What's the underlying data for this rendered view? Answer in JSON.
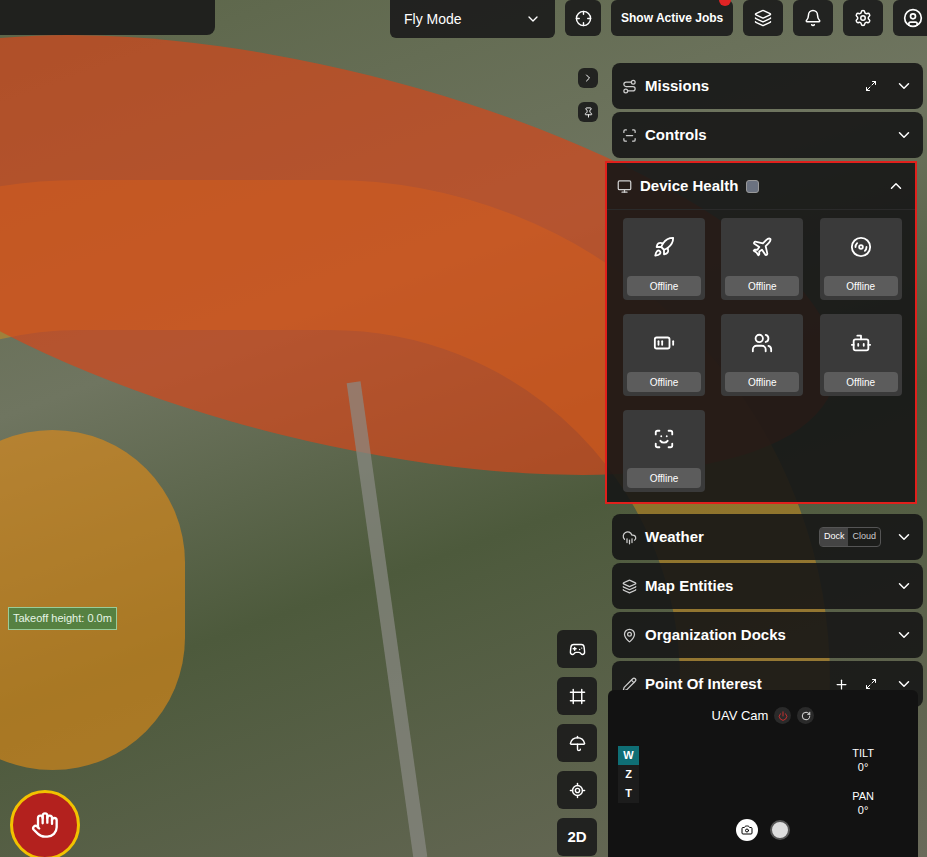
{
  "top_bar": {
    "mode_select": {
      "value": "Fly Mode"
    },
    "active_jobs_button": {
      "label": "Show Active Jobs",
      "has_badge": true
    }
  },
  "panel": {
    "sections": [
      {
        "title": "Missions",
        "expanded": false
      },
      {
        "title": "Controls",
        "expanded": false
      },
      {
        "title": "Device Health",
        "expanded": true,
        "highlighted": true,
        "checked": false,
        "tiles": [
          {
            "status": "Offline"
          },
          {
            "status": "Offline"
          },
          {
            "status": "Offline"
          },
          {
            "status": "Offline"
          },
          {
            "status": "Offline"
          },
          {
            "status": "Offline"
          },
          {
            "status": "Offline"
          }
        ]
      },
      {
        "title": "Weather",
        "expanded": false,
        "sources": [
          {
            "label": "Dock",
            "selected": true
          },
          {
            "label": "Cloud",
            "selected": false
          }
        ]
      },
      {
        "title": "Map Entities",
        "expanded": false
      },
      {
        "title": "Organization Docks",
        "expanded": false
      },
      {
        "title": "Point Of Interest",
        "expanded": false
      }
    ]
  },
  "map": {
    "takeoff_label": "Takeoff height: 0.0m"
  },
  "toolbar": {
    "view_toggle": "2D"
  },
  "uav_cam": {
    "title": "UAV Cam",
    "zoom_modes": [
      {
        "label": "W",
        "selected": true
      },
      {
        "label": "Z",
        "selected": false
      },
      {
        "label": "T",
        "selected": false
      }
    ],
    "tilt": {
      "label": "TILT",
      "value": "0°"
    },
    "pan": {
      "label": "PAN",
      "value": "0°"
    }
  }
}
